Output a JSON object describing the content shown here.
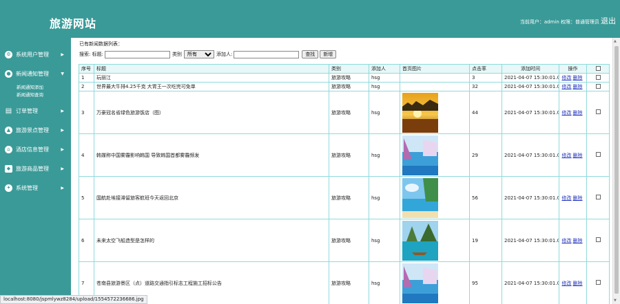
{
  "header": {
    "site_title": "旅游网站",
    "user_info": "当前用户：admin 权限：普通管理员",
    "logout": "退出"
  },
  "sidebar": {
    "items": [
      {
        "label": "系统用户管理",
        "icon": "gear-icon",
        "glyph": "⚙"
      },
      {
        "label": "新闻通知管理",
        "icon": "bell-icon",
        "glyph": "●",
        "expanded": true
      },
      {
        "label": "订单管理",
        "icon": "order-icon",
        "glyph": "▤"
      },
      {
        "label": "旅游景点管理",
        "icon": "scenic-icon",
        "glyph": "▲"
      },
      {
        "label": "酒店信息管理",
        "icon": "hotel-icon",
        "glyph": "⌂"
      },
      {
        "label": "旅游商品管理",
        "icon": "goods-icon",
        "glyph": "◆"
      },
      {
        "label": "系统管理",
        "icon": "system-icon",
        "glyph": "✦"
      }
    ],
    "subitems": [
      "新闻通知添加",
      "新闻通知查询"
    ]
  },
  "main": {
    "list_title": "已有新闻数据列表：",
    "search": {
      "prefix": "搜索: 标题:",
      "category_label": "类别",
      "category_selected": "所有",
      "adder_label": "添加人:",
      "search_button": "查找",
      "add_button": "新增"
    },
    "columns": [
      "序号",
      "标题",
      "类别",
      "添加人",
      "首页图片",
      "点击率",
      "添加时间",
      "操作",
      ""
    ],
    "rows": [
      {
        "no": "1",
        "title": "玩丽江",
        "category": "旅游攻略",
        "adder": "hsg",
        "image": "",
        "clicks": "3",
        "time": "2021-04-07 15:30:01.0",
        "edit": "修改",
        "delete": "删除"
      },
      {
        "no": "2",
        "title": "世界最大牛排4.25千克 大胃王一次吃完可免单",
        "category": "旅游攻略",
        "adder": "hsg",
        "image": "",
        "clicks": "32",
        "time": "2021-04-07 15:30:01.0",
        "edit": "修改",
        "delete": "删除"
      },
      {
        "no": "3",
        "title": "万豪冠名省绿色旅游饭店（图）",
        "category": "旅游攻略",
        "adder": "hsg",
        "image": "sunset-photo",
        "clicks": "44",
        "time": "2021-04-07 15:30:01.0",
        "edit": "修改",
        "delete": "删除"
      },
      {
        "no": "4",
        "title": "韩媒称中国雾霾影响韩国 导致韩国首都雾霾频发",
        "category": "旅游攻略",
        "adder": "hsg",
        "image": "pool-photo",
        "clicks": "29",
        "time": "2021-04-07 15:30:01.0",
        "edit": "修改",
        "delete": "删除"
      },
      {
        "no": "5",
        "title": "国航赴埃接滞留旅客航班今天返回北京",
        "category": "旅游攻略",
        "adder": "hsg",
        "image": "beach-photo",
        "clicks": "56",
        "time": "2021-04-07 15:30:01.0",
        "edit": "修改",
        "delete": "删除"
      },
      {
        "no": "6",
        "title": "未来太空飞船造型是怎样的",
        "category": "旅游攻略",
        "adder": "hsg",
        "image": "island-photo",
        "clicks": "19",
        "time": "2021-04-07 15:30:01.0",
        "edit": "修改",
        "delete": "删除"
      },
      {
        "no": "7",
        "title": "苍南县旅游景区（点）道路交通指引标志工程施工招标公告",
        "category": "旅游攻略",
        "adder": "hsg",
        "image": "pool-photo",
        "clicks": "95",
        "time": "2021-04-07 15:30:01.0",
        "edit": "修改",
        "delete": "删除"
      }
    ]
  },
  "status_bar": "localhost:8080/jspmlywz8284/upload/1554572236686.jpg"
}
